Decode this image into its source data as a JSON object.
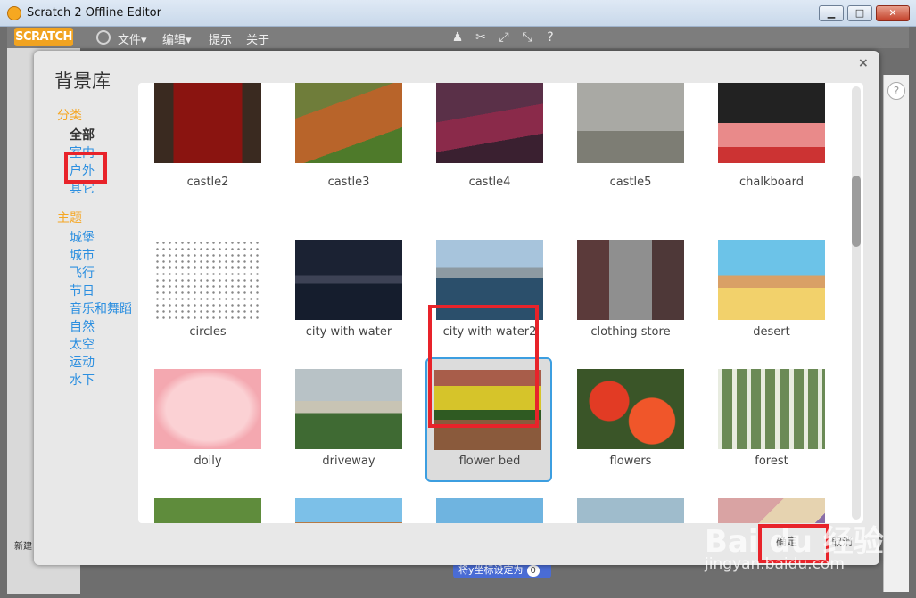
{
  "window": {
    "title": "Scratch 2 Offline Editor",
    "min_label": "▁",
    "max_label": "□",
    "close_label": "✕"
  },
  "menubar": {
    "logo": "SCRATCH",
    "file": "文件▾",
    "edit": "编辑▾",
    "tips": "提示",
    "about": "关于"
  },
  "background": {
    "new_sprite": "新建",
    "block_label": "将y坐标设定为",
    "block_value": "0"
  },
  "dialog": {
    "title": "背景库",
    "close": "×",
    "category_heading": "分类",
    "categories": [
      {
        "label": "全部",
        "active": true
      },
      {
        "label": "室内",
        "active": false
      },
      {
        "label": "户外",
        "active": false
      },
      {
        "label": "其它",
        "active": false
      }
    ],
    "theme_heading": "主题",
    "themes": [
      "城堡",
      "城市",
      "飞行",
      "节日",
      "音乐和舞蹈",
      "自然",
      "太空",
      "运动",
      "水下"
    ],
    "ok_label": "确定",
    "cancel_label": "取消"
  },
  "tiles": [
    {
      "name": "castle2",
      "icon": "castle2-image"
    },
    {
      "name": "castle3",
      "icon": "castle3-image"
    },
    {
      "name": "castle4",
      "icon": "castle4-image"
    },
    {
      "name": "castle5",
      "icon": "castle5-image"
    },
    {
      "name": "chalkboard",
      "icon": "chalkboard-image"
    },
    {
      "name": "circles",
      "icon": "circles-image"
    },
    {
      "name": "city with water",
      "icon": "city-image"
    },
    {
      "name": "city with water2",
      "icon": "city2-image"
    },
    {
      "name": "clothing store",
      "icon": "store-image"
    },
    {
      "name": "desert",
      "icon": "desert-image"
    },
    {
      "name": "doily",
      "icon": "doily-image"
    },
    {
      "name": "driveway",
      "icon": "driveway-image"
    },
    {
      "name": "flower bed",
      "icon": "flowerbed-image",
      "selected": true
    },
    {
      "name": "flowers",
      "icon": "flowers-image"
    },
    {
      "name": "forest",
      "icon": "forest-image"
    },
    {
      "name": "",
      "icon": "rock-image"
    },
    {
      "name": "",
      "icon": "gingerbread-image"
    },
    {
      "name": "",
      "icon": "goal1-image"
    },
    {
      "name": "",
      "icon": "goal2-image"
    },
    {
      "name": "",
      "icon": "graffiti-image"
    }
  ],
  "watermark": {
    "brand": "Bai du 经验",
    "url": "jingyan.baidu.com"
  }
}
